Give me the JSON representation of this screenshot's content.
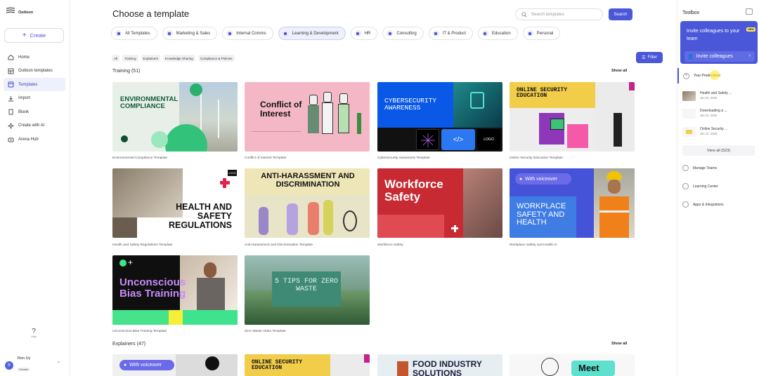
{
  "sidebar": {
    "org_name": "Outloon",
    "create_label": "Create",
    "nav": [
      {
        "label": "Home",
        "icon": "home-icon"
      },
      {
        "label": "Outloon templates",
        "icon": "templates-grid-icon"
      },
      {
        "label": "Templates",
        "icon": "template-icon",
        "active": true
      },
      {
        "label": "Import",
        "icon": "import-icon"
      },
      {
        "label": "Blank",
        "icon": "blank-page-icon"
      },
      {
        "label": "Create with AI",
        "icon": "sparkle-icon"
      },
      {
        "label": "Arena Hub",
        "icon": "arena-icon"
      }
    ],
    "help_label": "Help",
    "user": {
      "initials": "R",
      "name": "Ron Uy",
      "role": "Creator"
    }
  },
  "main": {
    "title": "Choose a template",
    "search_placeholder": "Search templates",
    "search_button": "Search",
    "categories": [
      {
        "label": "All Templates"
      },
      {
        "label": "Marketing & Sales"
      },
      {
        "label": "Internal Comms"
      },
      {
        "label": "Learning & Development",
        "active": true
      },
      {
        "label": "HR"
      },
      {
        "label": "Consulting"
      },
      {
        "label": "IT & Product"
      },
      {
        "label": "Education"
      },
      {
        "label": "Personal"
      }
    ],
    "chips": [
      "All",
      "Training",
      "Explainers",
      "Knowledge Sharing",
      "Compliance & Policies"
    ],
    "filter_button": "Filter",
    "sections": [
      {
        "title": "Training (51)",
        "show_all": "Show all"
      },
      {
        "title": "Explainers (47)",
        "show_all": "Show all"
      }
    ],
    "training_cards": [
      {
        "caption": "Environmental Compliance Template",
        "thumb_title": "ENVIRONMENTAL COMPLIANCE"
      },
      {
        "caption": "Conflict of Interest Template",
        "thumb_title": "Conflict of Interest"
      },
      {
        "caption": "Cybersecurity Awareness Template",
        "thumb_title": "CYBERSECURITY AWARENESS",
        "thumb_extra": "LOGO"
      },
      {
        "caption": "Online Security Education Template",
        "thumb_title": "ONLINE SECURITY EDUCATION"
      },
      {
        "caption": "Health and Safety Regulations Template",
        "thumb_title": "HEALTH AND SAFETY REGULATIONS",
        "thumb_extra": "LOGO"
      },
      {
        "caption": "Anti-Harassment and Discrimination Template",
        "thumb_title": "ANTI-HARASSMENT AND DISCRIMINATION"
      },
      {
        "caption": "Workforce Safety",
        "thumb_title": "Workforce Safety"
      },
      {
        "caption": "Workplace Safety and Health AI",
        "thumb_title": "WORKPLACE SAFETY AND HEALTH",
        "thumb_extra": "With voiceover"
      },
      {
        "caption": "Unconscious Bias Training Template",
        "thumb_title": "Unconscious Bias Training"
      },
      {
        "caption": "Zero Waste Video Template",
        "thumb_title": "5 TIPS FOR ZERO WASTE"
      }
    ],
    "explainer_cards": [
      {
        "thumb_title": "With voiceover"
      },
      {
        "thumb_title": "ONLINE SECURITY EDUCATION"
      },
      {
        "thumb_title": "FOOD INDUSTRY SOLUTIONS"
      },
      {
        "thumb_title": "Meet"
      }
    ]
  },
  "toolbox": {
    "title": "Toolbox",
    "invite_text": "Invite colleagues to your team",
    "new_badge": "NEW",
    "invite_button": "Invite colleagues",
    "your_productions": "Your Productions",
    "productions": [
      {
        "title": "Health and Safety ...",
        "date": "Jan 22, 2025"
      },
      {
        "title": "Downloading a ...",
        "date": "Jan 22, 2025"
      },
      {
        "title": "Online Security ...",
        "date": "Jan 22, 2025"
      }
    ],
    "view_all": "View all (523)",
    "links": [
      {
        "label": "Manage Teams",
        "icon": "team-icon"
      },
      {
        "label": "Learning Center",
        "icon": "learning-icon"
      },
      {
        "label": "Apps & Integrations",
        "icon": "apps-icon"
      }
    ]
  },
  "colors": {
    "accent": "#4a57d8",
    "active_bg": "#eef0fb"
  }
}
